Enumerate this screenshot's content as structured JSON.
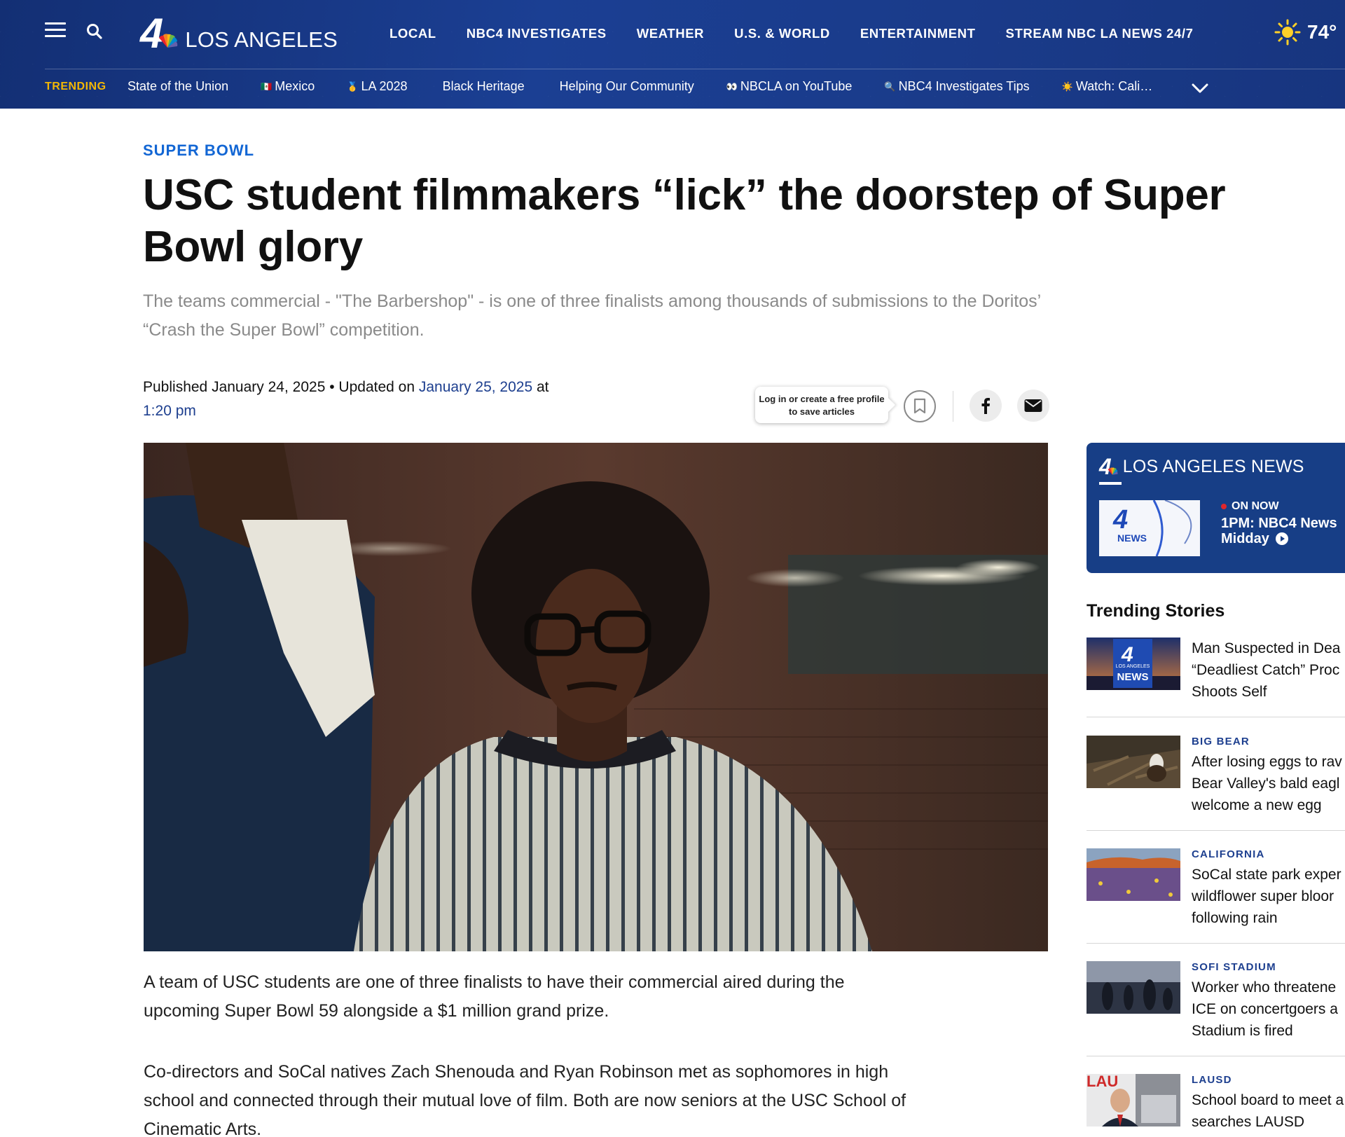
{
  "header": {
    "city": "LOS ANGELES",
    "logo_number": "4",
    "nav": [
      "LOCAL",
      "NBC4 INVESTIGATES",
      "WEATHER",
      "U.S. & WORLD",
      "ENTERTAINMENT",
      "STREAM NBC LA NEWS 24/7"
    ],
    "temperature": "74°",
    "weather_icon": "sun-icon",
    "trending_label": "TRENDING",
    "trending": [
      {
        "emoji": "",
        "label": "State of the Union"
      },
      {
        "emoji": "🇲🇽",
        "label": "Mexico"
      },
      {
        "emoji": "🥇",
        "label": "LA 2028"
      },
      {
        "emoji": "",
        "label": "Black Heritage"
      },
      {
        "emoji": "",
        "label": "Helping Our Community"
      },
      {
        "emoji": "👀",
        "label": "NBCLA on YouTube"
      },
      {
        "emoji": "🔍",
        "label": "NBC4 Investigates Tips"
      },
      {
        "emoji": "☀️",
        "label": "Watch: Cali…"
      }
    ]
  },
  "article": {
    "category": "SUPER BOWL",
    "headline": "USC student filmmakers “lick” the doorstep of Super Bowl glory",
    "dek": "The teams commercial - \"The Barbershop\" - is one of three finalists among thousands of submissions to the Doritos’  “Crash the Super Bowl” competition.",
    "published_prefix": "Published",
    "published_date": "January 24, 2025",
    "bullet": "•",
    "updated_prefix": "Updated on",
    "updated_date": "January 25, 2025",
    "at_word": "at",
    "updated_time": "1:20 pm",
    "save_tooltip": "Log in or create a free profile to save articles",
    "paragraphs": [
      "A team of USC students are one of three finalists to have their commercial aired during the upcoming Super Bowl 59 alongside a $1 million grand prize.",
      "Co-directors and SoCal natives Zach Shenouda and Ryan Robinson met as sophomores in high school and connected through their mutual love of film. Both are now seniors at the USC School of Cinematic Arts."
    ]
  },
  "sidebar": {
    "news_card": {
      "title": "LOS ANGELES NEWS",
      "logo_number": "4",
      "thumb_label": "NEWS",
      "on_now": "ON NOW",
      "program": "1PM: NBC4 News Midday"
    },
    "trending_title": "Trending Stories",
    "stories": [
      {
        "category": "",
        "title_lines": [
          "Man Suspected in Dea",
          "“Deadliest Catch” Proc",
          "Shoots Self"
        ],
        "thumb_label": "NEWS",
        "thumb_sub": "LOS ANGELES"
      },
      {
        "category": "BIG BEAR",
        "title_lines": [
          "After losing eggs to rav",
          "Bear Valley's bald eagl",
          "welcome a new egg"
        ]
      },
      {
        "category": "CALIFORNIA",
        "title_lines": [
          "SoCal state park exper",
          "wildflower super bloor",
          "following rain"
        ]
      },
      {
        "category": "SOFI STADIUM",
        "title_lines": [
          "Worker who threatene",
          "ICE on concertgoers a",
          "Stadium is fired"
        ]
      },
      {
        "category": "LAUSD",
        "title_lines": [
          "School board to meet a",
          "searches LAUSD"
        ],
        "thumb_label": "LAU"
      }
    ]
  },
  "colors": {
    "header_blue": "#1b3f93",
    "trending_yellow": "#f2b705",
    "category_blue": "#1266d4",
    "link_navy": "#1d3f8f"
  }
}
